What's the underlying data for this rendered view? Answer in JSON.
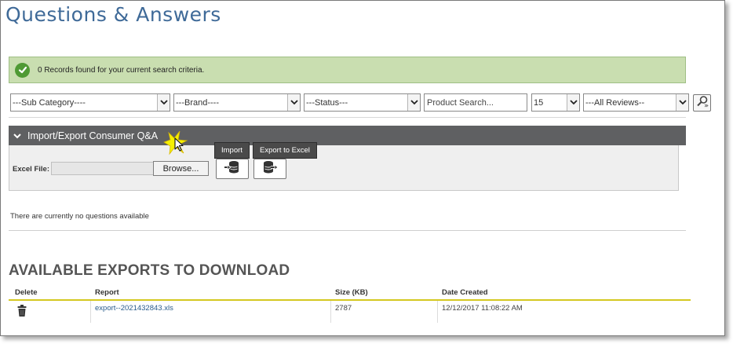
{
  "page": {
    "title": "Questions & Answers"
  },
  "alert": {
    "message": "0 Records found for your current search criteria.",
    "icon": "checkmark-icon",
    "color": "#c9deb0"
  },
  "filters": {
    "sub_category": "---Sub Category----",
    "brand": "---Brand----",
    "status": "---Status---",
    "product_search_placeholder": "Product Search...",
    "page_size": "15",
    "reviews": "---All Reviews--"
  },
  "import_export": {
    "section_title": "Import/Export Consumer Q&A",
    "excel_file_label": "Excel File:",
    "browse_label": "Browse...",
    "import_tooltip": "Import",
    "export_tooltip": "Export to Excel"
  },
  "questions": {
    "empty_message": "There are currently no questions available"
  },
  "exports": {
    "title": "AVAILABLE EXPORTS TO DOWNLOAD",
    "columns": {
      "delete": "Delete",
      "report": "Report",
      "size": "Size (KB)",
      "date": "Date Created"
    },
    "rows": [
      {
        "report": "export--2021432843.xls",
        "size": "2787",
        "date": "12/12/2017 11:08:22 AM"
      }
    ]
  },
  "colors": {
    "title": "#3f6a98",
    "section_bar": "#5f6062",
    "table_accent": "#d4c820"
  }
}
